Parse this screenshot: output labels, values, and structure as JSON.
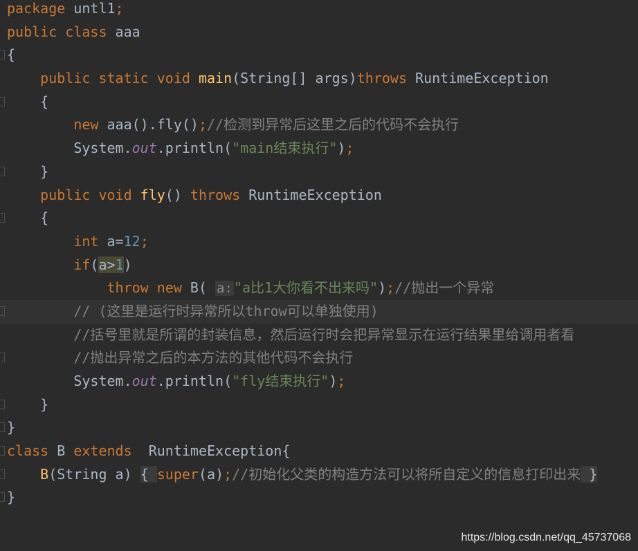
{
  "theme_colors": {
    "background": "#2b2b2b",
    "keyword": "#cc7832",
    "text": "#a9b7c6",
    "method": "#ffc66d",
    "number": "#6897bb",
    "string": "#6a8759",
    "comment": "#808080",
    "field": "#9876aa"
  },
  "lines": [
    {
      "indent": 0,
      "tokens": [
        {
          "c": "kw",
          "t": "package "
        },
        {
          "c": "txt",
          "t": "untl1"
        },
        {
          "c": "kw",
          "t": ";"
        }
      ]
    },
    {
      "indent": 0,
      "tokens": [
        {
          "c": "kw",
          "t": "public class "
        },
        {
          "c": "txt",
          "t": "aaa"
        }
      ]
    },
    {
      "indent": 0,
      "fold": true,
      "tokens": [
        {
          "c": "txt",
          "t": "{"
        }
      ]
    },
    {
      "indent": 1,
      "tokens": [
        {
          "c": "kw",
          "t": "public static void "
        },
        {
          "c": "fn",
          "t": "main"
        },
        {
          "c": "txt",
          "t": "(String[] args)"
        },
        {
          "c": "kw",
          "t": "throws "
        },
        {
          "c": "txt",
          "t": "RuntimeException"
        }
      ]
    },
    {
      "indent": 1,
      "fold": true,
      "tokens": [
        {
          "c": "txt",
          "t": "{"
        }
      ]
    },
    {
      "indent": 2,
      "tokens": [
        {
          "c": "kw",
          "t": "new "
        },
        {
          "c": "txt",
          "t": "aaa().fly()"
        },
        {
          "c": "kw",
          "t": ";"
        },
        {
          "c": "cmt",
          "t": "//检测到异常后这里之后的代码不会执行"
        }
      ]
    },
    {
      "indent": 2,
      "tokens": [
        {
          "c": "txt",
          "t": "System."
        },
        {
          "c": "fld",
          "t": "out"
        },
        {
          "c": "txt",
          "t": ".println("
        },
        {
          "c": "str",
          "t": "\"main结束执行\""
        },
        {
          "c": "txt",
          "t": ")"
        },
        {
          "c": "kw",
          "t": ";"
        }
      ]
    },
    {
      "indent": 1,
      "fold": true,
      "tokens": [
        {
          "c": "txt",
          "t": "}"
        }
      ]
    },
    {
      "indent": 1,
      "tokens": [
        {
          "c": "kw",
          "t": "public void "
        },
        {
          "c": "fn",
          "t": "fly"
        },
        {
          "c": "txt",
          "t": "() "
        },
        {
          "c": "kw",
          "t": "throws "
        },
        {
          "c": "txt",
          "t": "RuntimeException"
        }
      ]
    },
    {
      "indent": 1,
      "fold": true,
      "tokens": [
        {
          "c": "txt",
          "t": "{"
        }
      ]
    },
    {
      "indent": 2,
      "tokens": [
        {
          "c": "kw",
          "t": "int "
        },
        {
          "c": "txt",
          "t": "a="
        },
        {
          "c": "num",
          "t": "12"
        },
        {
          "c": "kw",
          "t": ";"
        }
      ]
    },
    {
      "indent": 2,
      "tokens": [
        {
          "c": "kw",
          "t": "if"
        },
        {
          "c": "txt",
          "t": "("
        },
        {
          "c": "txt hl",
          "t": "a>"
        },
        {
          "c": "num hl",
          "t": "1"
        },
        {
          "c": "txt",
          "t": ")"
        }
      ]
    },
    {
      "indent": 3,
      "tokens": [
        {
          "c": "kw",
          "t": "throw new "
        },
        {
          "c": "txt",
          "t": "B( "
        },
        {
          "c": "hint",
          "t": "a:"
        },
        {
          "c": "str",
          "t": "\"a比1大你看不出来吗\""
        },
        {
          "c": "txt",
          "t": ")"
        },
        {
          "c": "kw",
          "t": ";"
        },
        {
          "c": "cmt",
          "t": "//抛出一个异常"
        }
      ]
    },
    {
      "indent": 2,
      "current": true,
      "fold": true,
      "tokens": [
        {
          "c": "cmt",
          "t": "// (这里是运行时异常所以throw可以单独使用)"
        }
      ]
    },
    {
      "indent": 2,
      "tokens": [
        {
          "c": "cmt",
          "t": "//括号里就是所谓的封装信息，然后运行时会把异常显示在运行结果里给调用者看"
        }
      ]
    },
    {
      "indent": 2,
      "fold": true,
      "tokens": [
        {
          "c": "cmt",
          "t": "//抛出异常之后的本方法的其他代码不会执行"
        }
      ]
    },
    {
      "indent": 2,
      "tokens": [
        {
          "c": "txt",
          "t": "System."
        },
        {
          "c": "fld",
          "t": "out"
        },
        {
          "c": "txt",
          "t": ".println("
        },
        {
          "c": "str",
          "t": "\"fly结束执行\""
        },
        {
          "c": "txt",
          "t": ")"
        },
        {
          "c": "kw",
          "t": ";"
        }
      ]
    },
    {
      "indent": 1,
      "fold": true,
      "tokens": [
        {
          "c": "txt",
          "t": "}"
        }
      ]
    },
    {
      "indent": 0,
      "fold": true,
      "tokens": [
        {
          "c": "txt",
          "t": "}"
        }
      ]
    },
    {
      "indent": 0,
      "fold": true,
      "tokens": [
        {
          "c": "kw",
          "t": "class "
        },
        {
          "c": "txt",
          "t": "B "
        },
        {
          "c": "kw",
          "t": "extends  "
        },
        {
          "c": "txt",
          "t": "RuntimeException{"
        }
      ]
    },
    {
      "indent": 1,
      "fold": true,
      "tokens": [
        {
          "c": "fn",
          "t": "B"
        },
        {
          "c": "txt",
          "t": "(String a) "
        },
        {
          "c": "txt brk",
          "t": "{ "
        },
        {
          "c": "kw",
          "t": "super"
        },
        {
          "c": "txt",
          "t": "(a)"
        },
        {
          "c": "kw",
          "t": ";"
        },
        {
          "c": "cmt",
          "t": "//初始化父类的构造方法可以将所自定义的信息打印出来"
        },
        {
          "c": "txt brk",
          "t": " }"
        }
      ]
    },
    {
      "indent": 0,
      "fold": true,
      "tokens": [
        {
          "c": "txt",
          "t": "}"
        }
      ]
    }
  ],
  "watermark": "https://blog.csdn.net/qq_45737068"
}
